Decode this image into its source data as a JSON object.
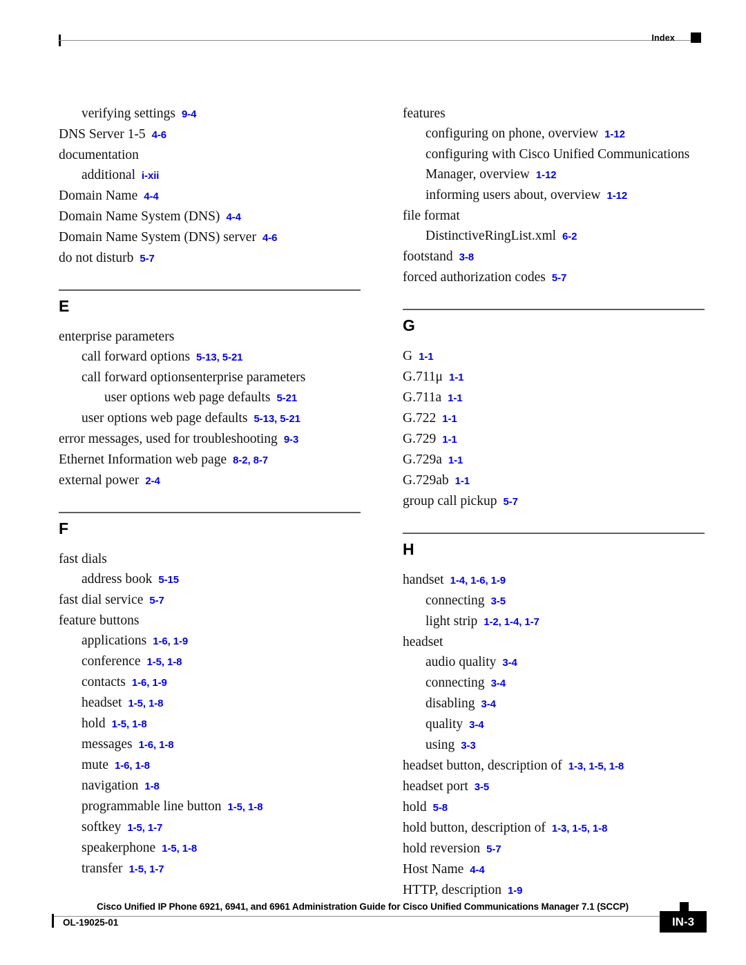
{
  "header": {
    "label": "Index"
  },
  "columns": {
    "left": [
      {
        "letter": null,
        "entries": [
          {
            "level": 1,
            "term": "verifying settings",
            "refs": "9-4"
          },
          {
            "level": 0,
            "term": "DNS Server 1-5",
            "refs": "4-6"
          },
          {
            "level": 0,
            "term": "documentation",
            "refs": ""
          },
          {
            "level": 1,
            "term": "additional",
            "refs": "i-xii"
          },
          {
            "level": 0,
            "term": "Domain Name",
            "refs": "4-4"
          },
          {
            "level": 0,
            "term": "Domain Name System (DNS)",
            "refs": "4-4"
          },
          {
            "level": 0,
            "term": "Domain Name System (DNS) server",
            "refs": "4-6"
          },
          {
            "level": 0,
            "term": "do not disturb",
            "refs": "5-7"
          }
        ]
      },
      {
        "letter": "E",
        "entries": [
          {
            "level": 0,
            "term": "enterprise parameters",
            "refs": ""
          },
          {
            "level": 1,
            "term": "call forward options",
            "refs": "5-13, 5-21"
          },
          {
            "level": 1,
            "term": "call forward optionsenterprise parameters",
            "refs": ""
          },
          {
            "level": 2,
            "term": "user options web page defaults",
            "refs": "5-21"
          },
          {
            "level": 1,
            "term": "user options web page defaults",
            "refs": "5-13, 5-21"
          },
          {
            "level": 0,
            "term": "error messages, used for troubleshooting",
            "refs": "9-3"
          },
          {
            "level": 0,
            "term": "Ethernet Information web page",
            "refs": "8-2, 8-7"
          },
          {
            "level": 0,
            "term": "external power",
            "refs": "2-4"
          }
        ]
      },
      {
        "letter": "F",
        "entries": [
          {
            "level": 0,
            "term": "fast dials",
            "refs": ""
          },
          {
            "level": 1,
            "term": "address book",
            "refs": "5-15"
          },
          {
            "level": 0,
            "term": "fast dial service",
            "refs": "5-7"
          },
          {
            "level": 0,
            "term": "feature buttons",
            "refs": ""
          },
          {
            "level": 1,
            "term": "applications",
            "refs": "1-6, 1-9"
          },
          {
            "level": 1,
            "term": "conference",
            "refs": "1-5, 1-8"
          },
          {
            "level": 1,
            "term": "contacts",
            "refs": "1-6, 1-9"
          },
          {
            "level": 1,
            "term": "headset",
            "refs": "1-5, 1-8"
          },
          {
            "level": 1,
            "term": "hold",
            "refs": "1-5, 1-8"
          },
          {
            "level": 1,
            "term": "messages",
            "refs": "1-6, 1-8"
          },
          {
            "level": 1,
            "term": "mute",
            "refs": "1-6, 1-8"
          },
          {
            "level": 1,
            "term": "navigation",
            "refs": "1-8"
          },
          {
            "level": 1,
            "term": "programmable line button",
            "refs": "1-5, 1-8"
          },
          {
            "level": 1,
            "term": "softkey",
            "refs": "1-5, 1-7"
          },
          {
            "level": 1,
            "term": "speakerphone",
            "refs": "1-5, 1-8"
          },
          {
            "level": 1,
            "term": "transfer",
            "refs": "1-5, 1-7"
          }
        ]
      }
    ],
    "right": [
      {
        "letter": null,
        "entries": [
          {
            "level": 0,
            "term": "features",
            "refs": ""
          },
          {
            "level": 1,
            "term": "configuring on phone, overview",
            "refs": "1-12"
          },
          {
            "level": 1,
            "term": "configuring with Cisco Unified Communications Manager, overview",
            "refs": "1-12"
          },
          {
            "level": 1,
            "term": "informing users about, overview",
            "refs": "1-12"
          },
          {
            "level": 0,
            "term": "file format",
            "refs": ""
          },
          {
            "level": 1,
            "term": "DistinctiveRingList.xml",
            "refs": "6-2"
          },
          {
            "level": 0,
            "term": "footstand",
            "refs": "3-8"
          },
          {
            "level": 0,
            "term": "forced authorization codes",
            "refs": "5-7"
          }
        ]
      },
      {
        "letter": "G",
        "entries": [
          {
            "level": 0,
            "term": "G",
            "refs": "1-1"
          },
          {
            "level": 0,
            "term": "G.711μ",
            "refs": "1-1"
          },
          {
            "level": 0,
            "term": "G.711a",
            "refs": "1-1"
          },
          {
            "level": 0,
            "term": "G.722",
            "refs": "1-1"
          },
          {
            "level": 0,
            "term": "G.729",
            "refs": "1-1"
          },
          {
            "level": 0,
            "term": "G.729a",
            "refs": "1-1"
          },
          {
            "level": 0,
            "term": "G.729ab",
            "refs": "1-1"
          },
          {
            "level": 0,
            "term": "group call pickup",
            "refs": "5-7"
          }
        ]
      },
      {
        "letter": "H",
        "entries": [
          {
            "level": 0,
            "term": "handset",
            "refs": "1-4, 1-6, 1-9"
          },
          {
            "level": 1,
            "term": "connecting",
            "refs": "3-5"
          },
          {
            "level": 1,
            "term": "light strip",
            "refs": "1-2, 1-4, 1-7"
          },
          {
            "level": 0,
            "term": "headset",
            "refs": ""
          },
          {
            "level": 1,
            "term": "audio quality",
            "refs": "3-4"
          },
          {
            "level": 1,
            "term": "connecting",
            "refs": "3-4"
          },
          {
            "level": 1,
            "term": "disabling",
            "refs": "3-4"
          },
          {
            "level": 1,
            "term": "quality",
            "refs": "3-4"
          },
          {
            "level": 1,
            "term": "using",
            "refs": "3-3"
          },
          {
            "level": 0,
            "term": "headset button, description of",
            "refs": "1-3, 1-5, 1-8"
          },
          {
            "level": 0,
            "term": "headset port",
            "refs": "3-5"
          },
          {
            "level": 0,
            "term": "hold",
            "refs": "5-8"
          },
          {
            "level": 0,
            "term": "hold button, description of",
            "refs": "1-3, 1-5, 1-8"
          },
          {
            "level": 0,
            "term": "hold reversion",
            "refs": "5-7"
          },
          {
            "level": 0,
            "term": "Host Name",
            "refs": "4-4"
          },
          {
            "level": 0,
            "term": "HTTP, description",
            "refs": "1-9"
          }
        ]
      }
    ]
  },
  "footer": {
    "title": "Cisco Unified IP Phone 6921, 6941, and 6961 Administration Guide for Cisco Unified Communications Manager 7.1 (SCCP)",
    "doc_id": "OL-19025-01",
    "page_number": "IN-3"
  }
}
